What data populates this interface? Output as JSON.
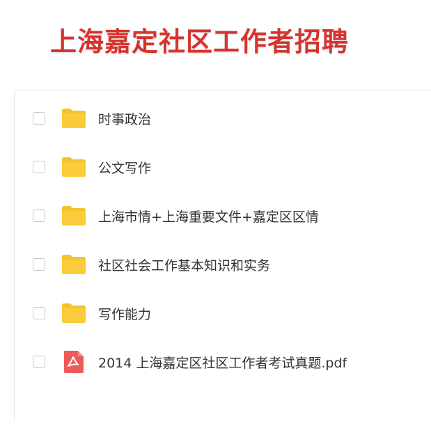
{
  "banner": {
    "title": "上海嘉定社区工作者招聘",
    "title_color": "#d6332f"
  },
  "files": [
    {
      "name": "时事政治",
      "type": "folder",
      "icon": "folder-icon",
      "checked": false
    },
    {
      "name": "公文写作",
      "type": "folder",
      "icon": "folder-icon",
      "checked": false
    },
    {
      "name": "上海市情+上海重要文件+嘉定区区情",
      "type": "folder",
      "icon": "folder-icon",
      "checked": false
    },
    {
      "name": "社区社会工作基本知识和实务",
      "type": "folder",
      "icon": "folder-icon",
      "checked": false
    },
    {
      "name": "写作能力",
      "type": "folder",
      "icon": "folder-icon",
      "checked": false
    },
    {
      "name": "2014 上海嘉定区社区工作者考试真题.pdf",
      "type": "pdf",
      "icon": "pdf-icon",
      "checked": false
    }
  ],
  "colors": {
    "folder": "#f5c32c",
    "pdf": "#ee5a5a",
    "text": "#333333"
  }
}
